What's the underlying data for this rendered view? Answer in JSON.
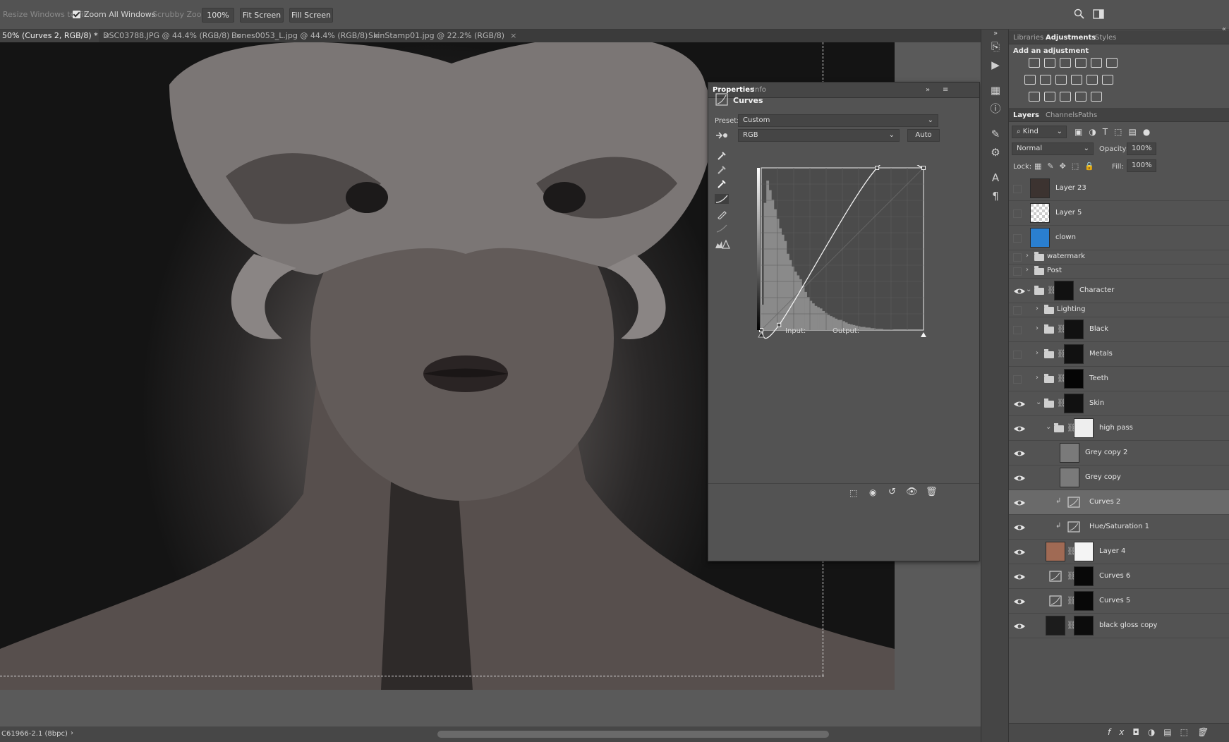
{
  "options_bar": {
    "resize_windows": "Resize Windows to Fit",
    "zoom_all": "Zoom All Windows",
    "scrubby": "Scrubby Zoom",
    "zoom_value": "100%",
    "fit_screen": "Fit Screen",
    "fill_screen": "Fill Screen"
  },
  "doc_tabs": [
    {
      "label": "50% (Curves 2, RGB/8) *",
      "close": "×"
    },
    {
      "label": "DSC03788.JPG @ 44.4% (RGB/8)",
      "close": "×"
    },
    {
      "label": "Bones0053_L.jpg @ 44.4% (RGB/8)",
      "close": "×"
    },
    {
      "label": "SkinStamp01.jpg @ 22.2% (RGB/8)",
      "close": "×"
    }
  ],
  "status": {
    "doc_info": "C61966-2.1 (8bpc)",
    "arrow": "›"
  },
  "properties": {
    "tab_properties": "Properties",
    "tab_info": "Info",
    "title": "Curves",
    "preset_label": "Preset:",
    "preset_value": "Custom",
    "channel_value": "RGB",
    "auto_label": "Auto",
    "input_label": "Input:",
    "output_label": "Output:"
  },
  "chart_data": {
    "type": "line",
    "title": "",
    "xlabel": "Input:",
    "ylabel": "Output:",
    "xlim": [
      0,
      255
    ],
    "ylim": [
      0,
      255
    ],
    "grid": true,
    "series": [
      {
        "x": [
          0,
          28,
          182,
          255
        ],
        "y": [
          0,
          8,
          255,
          255
        ]
      }
    ],
    "control_points": [
      {
        "x": 0,
        "y": 0
      },
      {
        "x": 28,
        "y": 8
      },
      {
        "x": 182,
        "y": 255
      },
      {
        "x": 255,
        "y": 255
      }
    ],
    "histogram": [
      40,
      200,
      235,
      220,
      205,
      190,
      175,
      160,
      150,
      140,
      120,
      110,
      100,
      92,
      86,
      80,
      70,
      60,
      52,
      46,
      42,
      38,
      36,
      34,
      30,
      27,
      24,
      22,
      20,
      18,
      16,
      16,
      14,
      12,
      10,
      9,
      8,
      7,
      6,
      5,
      5,
      4,
      4,
      3,
      3,
      2,
      2,
      2,
      1,
      1,
      1,
      1,
      0,
      0,
      0,
      0,
      0,
      0,
      0,
      0,
      0,
      0,
      0,
      0
    ]
  },
  "right_panel": {
    "tabs_top": [
      "Libraries",
      "Adjustments",
      "Styles"
    ],
    "add_adjustment": "Add an adjustment",
    "tabs_layers": [
      "Layers",
      "Channels",
      "Paths"
    ],
    "kind_label": "Kind",
    "blend_mode": "Normal",
    "opacity_label": "Opacity:",
    "opacity_value": "100%",
    "lock_label": "Lock:",
    "fill_label": "Fill:",
    "fill_value": "100%"
  },
  "layers": [
    {
      "name": "Layer 23",
      "visible": false
    },
    {
      "name": "Layer 5",
      "visible": false
    },
    {
      "name": "clown",
      "visible": false
    },
    {
      "name": "watermark",
      "visible": false
    },
    {
      "name": "Post",
      "visible": false
    },
    {
      "name": "Character",
      "visible": true
    },
    {
      "name": "Lighting",
      "visible": false
    },
    {
      "name": "Black",
      "visible": false
    },
    {
      "name": "Metals",
      "visible": false
    },
    {
      "name": "Teeth",
      "visible": false
    },
    {
      "name": "Skin",
      "visible": true
    },
    {
      "name": "high pass",
      "visible": true
    },
    {
      "name": "Grey copy 2",
      "visible": true
    },
    {
      "name": "Grey copy",
      "visible": true
    },
    {
      "name": "Curves 2",
      "visible": true,
      "selected": true
    },
    {
      "name": "Hue/Saturation 1",
      "visible": true
    },
    {
      "name": "Layer 4",
      "visible": true
    },
    {
      "name": "Curves 6",
      "visible": true
    },
    {
      "name": "Curves 5",
      "visible": true
    },
    {
      "name": "black gloss copy",
      "visible": true
    }
  ],
  "colors": {
    "ui_bg": "#535353",
    "panel_dark": "#424242",
    "selected_row": "#6a6a6a"
  }
}
